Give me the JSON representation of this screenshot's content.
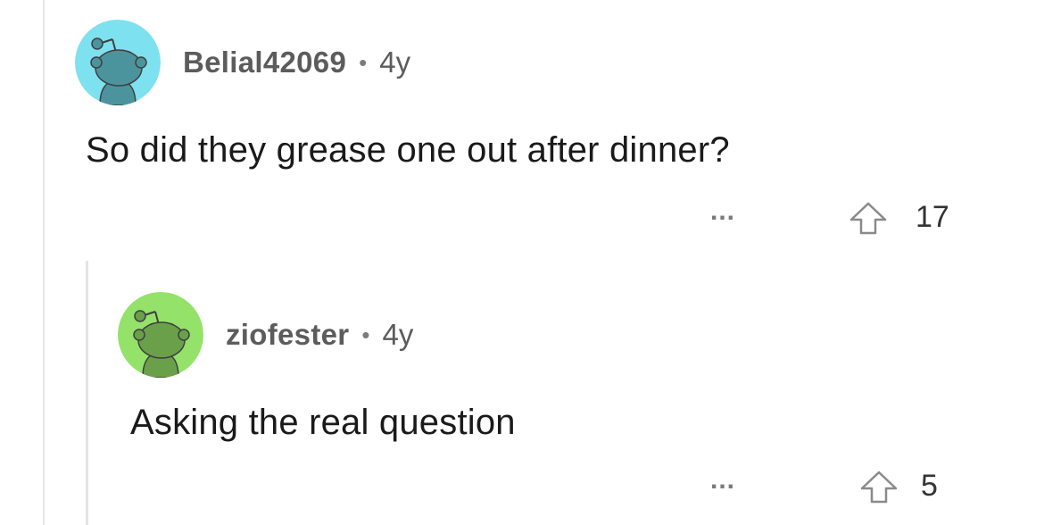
{
  "comments": [
    {
      "username": "Belial42069",
      "separator": "•",
      "age": "4y",
      "body": "So did they grease one out after dinner?",
      "more_label": "...",
      "upvote_icon": "upvote-arrow-icon",
      "votes": "17",
      "avatar_color": "#7ee1ef",
      "avatar_figure_color": "#4b949e"
    },
    {
      "username": "ziofester",
      "separator": "•",
      "age": "4y",
      "body": "Asking the real question",
      "more_label": "...",
      "upvote_icon": "upvote-arrow-icon",
      "votes": "5",
      "avatar_color": "#94e26a",
      "avatar_figure_color": "#6aa04a"
    }
  ]
}
